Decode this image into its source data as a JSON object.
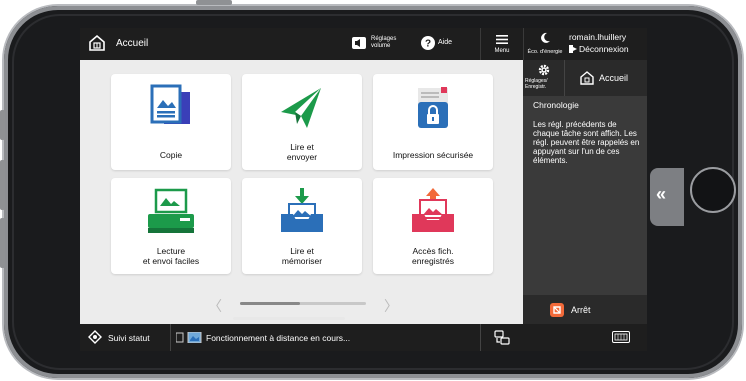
{
  "topbar": {
    "home_label": "Accueil",
    "volume_label_line1": "Réglages",
    "volume_label_line2": "volume",
    "help_label": "Aide",
    "menu_label": "Menu"
  },
  "right_panel": {
    "eco_label": "Éco. d'énergie",
    "user_name": "romain.lhuillery",
    "logout_label": "Déconnexion",
    "settings_line1": "Réglages/",
    "settings_line2": "Enregistr.",
    "home_label": "Accueil",
    "history_title": "Chronologie",
    "history_text": "Les régl. précédents de chaque tâche sont affich. Les régl. peuvent être rappelés en appuyant sur l'un de ces éléments.",
    "stop_label": "Arrêt"
  },
  "tiles": [
    {
      "line1": "Copie",
      "line2": ""
    },
    {
      "line1": "Lire et",
      "line2": "envoyer"
    },
    {
      "line1": "Impression sécurisée",
      "line2": ""
    },
    {
      "line1": "Lecture",
      "line2": "et envoi faciles"
    },
    {
      "line1": "Lire et",
      "line2": "mémoriser"
    },
    {
      "line1": "Accès fich.",
      "line2": "enregistrés"
    }
  ],
  "pager": {
    "left_glyph": "〈",
    "right_glyph": "〉",
    "position": 0.0,
    "fraction_visible": 0.48
  },
  "status_bar": {
    "status_label": "Suivi statut",
    "remote_text": "Fonctionnement à distance en cours..."
  },
  "side_tab_glyph": "«",
  "colors": {
    "accent_blue": "#2b6fb8",
    "accent_green": "#1c9a4a",
    "accent_red": "#e0385a",
    "stop_orange": "#f26a3a",
    "dark_bar": "#1e1e1e",
    "panel_gray": "#3a3a3a"
  },
  "icons": [
    "home-icon",
    "volume-icon",
    "help-icon",
    "menu-icon",
    "moon-icon",
    "logout-icon",
    "gear-icon",
    "stop-icon",
    "keyboard-icon",
    "status-icon",
    "remote-icon",
    "network-icon"
  ]
}
